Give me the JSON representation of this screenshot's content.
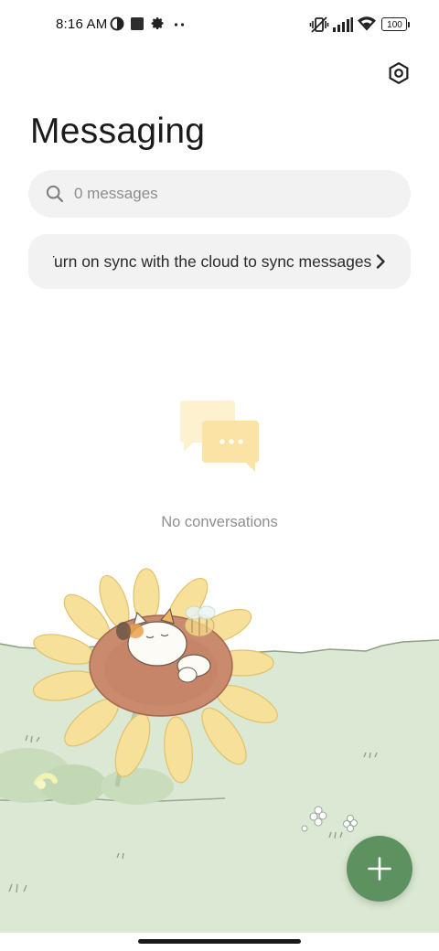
{
  "status_bar": {
    "time": "8:16 AM",
    "battery": "100",
    "left_icons": [
      "data-saver-icon",
      "square-notification-icon",
      "settings-gear-icon",
      "more-dots-icon"
    ],
    "right_icons": [
      "vibrate-icon",
      "signal-icon",
      "wifi-icon",
      "battery-icon"
    ]
  },
  "header": {
    "title": "Messaging",
    "settings_icon": "settings-hexagon-icon"
  },
  "search": {
    "placeholder": "0 messages",
    "value": ""
  },
  "sync_banner": {
    "text": "Turn on sync with the cloud to sync messages",
    "icon": "chevron-right-icon"
  },
  "empty_state": {
    "icon": "chat-bubbles-icon",
    "label": "No conversations"
  },
  "fab": {
    "icon": "plus-icon"
  },
  "colors": {
    "accent": "#5e9160",
    "grass": "#dbe8d3",
    "sunflower_petal": "#f6dc87",
    "sunflower_center": "#c98a6d",
    "surface": "#f2f2f2",
    "empty_icon": "#fbe3a5"
  }
}
